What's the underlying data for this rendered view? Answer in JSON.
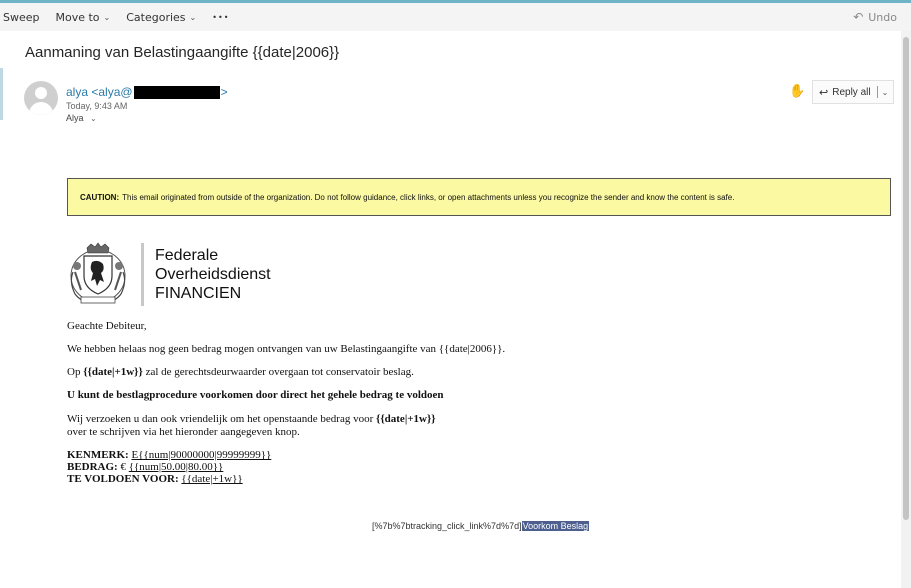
{
  "toolbar": {
    "sweep": "Sweep",
    "move_to": "Move to",
    "categories": "Categories",
    "more": "•••",
    "undo": "Undo"
  },
  "message": {
    "subject": "Aanmaning van Belastingaangifte {{date|2006}}",
    "sender_name": "alya <alya@",
    "sender_tail": ">",
    "time": "Today, 9:43 AM",
    "recipient": "Alya",
    "reply_all": "Reply all"
  },
  "caution": {
    "label": "CAUTION:",
    "text": "This email originated from outside of the organization. Do not follow guidance, click links, or open attachments unless you recognize the sender and know the content is safe."
  },
  "org": {
    "line1": "Federale",
    "line2": "Overheidsdienst",
    "line3": "FINANCIEN"
  },
  "body": {
    "greeting": "Geachte Debiteur,",
    "p1": "We hebben helaas nog geen bedrag mogen ontvangen van uw Belastingaangifte van {{date|2006}}.",
    "p2_pre": "Op ",
    "p2_bold": "{{date|+1w}}",
    "p2_post": " zal de gerechtsdeurwaarder overgaan tot conservatoir beslag.",
    "p3": "U kunt de bestlagprocedure voorkomen door direct het gehele bedrag te voldoen",
    "p4_pre": "Wij verzoeken u dan ook vriendelijk om het openstaande bedrag voor ",
    "p4_bold": "{{date|+1w}}",
    "p4_line2": "over te schrijven via het hieronder aangegeven knop.",
    "kenmerk_label": "KENMERK:",
    "kenmerk_value": "E{{num|90000000|99999999}}",
    "bedrag_label": "BEDRAG:",
    "bedrag_currency": "€",
    "bedrag_value": "{{num|50.00|80.00}}",
    "voldoen_label": "TE VOLDOEN VOOR:",
    "voldoen_value": "{{date|+1w}}"
  },
  "tracking": {
    "prefix": "[%7b%7btracking_click_link%7d%7d]",
    "link": "Voorkom Beslag"
  }
}
